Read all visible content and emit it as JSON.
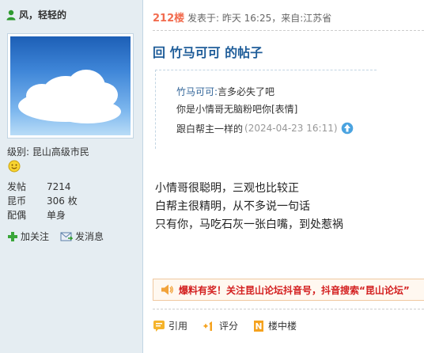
{
  "author": {
    "name": "风，轻轻的"
  },
  "profile": {
    "level_label": "级别:",
    "level_value": "昆山高级市民",
    "stats": [
      {
        "key": "发帖",
        "value": "7214"
      },
      {
        "key": "昆币",
        "value": "306 枚"
      },
      {
        "key": "配偶",
        "value": "单身"
      }
    ],
    "add_follow": "加关注",
    "send_message": "发消息"
  },
  "post": {
    "floor": "212楼",
    "meta": "发表于: 昨天 16:25，来自:江苏省",
    "title": "回 竹马可可 的帖子",
    "quote": {
      "author": "竹马可可:",
      "line1": "言多必失了吧",
      "line2": "你是小情哥无脑粉吧你[表情]",
      "line3": "跟白帮主一样的",
      "timestamp": "(2024-04-23 16:11)"
    },
    "body": [
      "小情哥很聪明，三观也比较正",
      "白帮主很精明，从不多说一句话",
      "只有你，马吃石灰一张白嘴，到处惹祸"
    ]
  },
  "banner": {
    "text": "爆料有奖！关注昆山论坛抖音号，抖音搜索“昆山论坛”"
  },
  "footer": {
    "quote": "引用",
    "rate": "评分",
    "floor_in_floor": "楼中楼"
  },
  "colors": {
    "accent": "#1f5d99",
    "floor": "#f26c4f",
    "sidebar": "#e5edf2",
    "banner_text": "#d31f1f"
  }
}
